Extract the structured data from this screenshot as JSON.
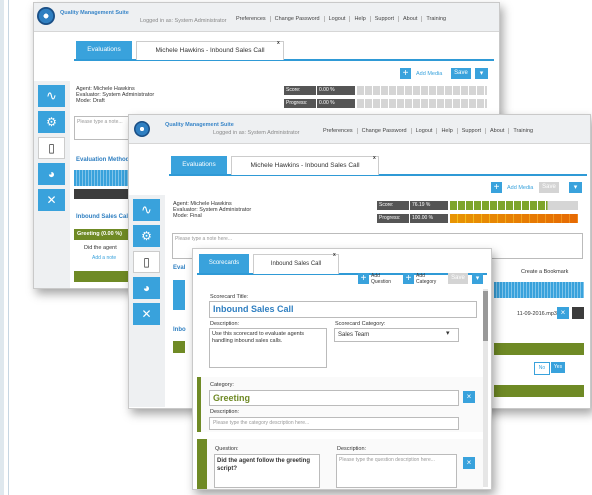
{
  "header": {
    "app_title": "Quality Management Suite",
    "logged_in": "Logged in as: System Administrator",
    "nav": [
      "Preferences",
      "Change Password",
      "Logout",
      "Help",
      "Support",
      "About",
      "Training"
    ]
  },
  "tabs": {
    "evaluations": "Evaluations",
    "active": "Michele Hawkins - Inbound Sales Call",
    "close": "x"
  },
  "toolbar": {
    "add_media": "Add Media",
    "save": "Save",
    "plus": "+",
    "chevron": "▾"
  },
  "back_window": {
    "agent": "Agent: Michele Hawkins",
    "evaluator": "Evaluator: System Administrator",
    "mode": "Mode: Draft",
    "score_label": "Score:",
    "score_value": "0.00 %",
    "progress_label": "Progress:",
    "progress_value": "0.00 %",
    "note_placeholder": "Please type a note...",
    "eval_methods": "Evaluation Methods",
    "inbound": "Inbound Sales Call",
    "greeting": "Greeting (0.00 %)",
    "question_partial": "Did the agent",
    "add_note": "Add a note"
  },
  "mid_window": {
    "agent": "Agent: Michele Hawkins",
    "evaluator": "Evaluator: System Administrator",
    "mode": "Mode: Final",
    "score_label": "Score:",
    "score_value": "76.19 %",
    "progress_label": "Progress:",
    "progress_value": "100.00 %",
    "note_placeholder": "Please type a note here...",
    "bookmark": "Create a Bookmark",
    "date": "11-09-2016.mp3",
    "no": "No",
    "yes": "Yes",
    "partial_labels": [
      "Eval",
      "Inbo"
    ]
  },
  "scorecard": {
    "tab_scorecards": "Scorecards",
    "tab_active": "Inbound Sales Call",
    "add_question": "Add Question",
    "add_category": "Add Category",
    "save": "Save",
    "title_label": "Scorecard Title:",
    "title_value": "Inbound Sales Call",
    "desc_label": "Description:",
    "desc_value": "Use this scorecard to evaluate agents handling inbound sales calls.",
    "category_label": "Scorecard Category:",
    "category_value": "Sales Team",
    "cat_label": "Category:",
    "cat_value": "Greeting",
    "cat_desc_label": "Description:",
    "cat_desc_placeholder": "Please type the category description here...",
    "q_label": "Question:",
    "q_value": "Did the agent follow the greeting script?",
    "q_desc_label": "Description:",
    "q_desc_placeholder": "Please type the question description here...",
    "remove": "×"
  },
  "colors": {
    "accent": "#39a2dc",
    "green": "#6f8a25",
    "yellow": "#f3c31a",
    "orange": "#f18a1c"
  },
  "icons": {
    "sidebar": [
      "pulse-icon",
      "gear-icon",
      "clipboard-icon",
      "chart-icon",
      "tools-icon"
    ]
  }
}
